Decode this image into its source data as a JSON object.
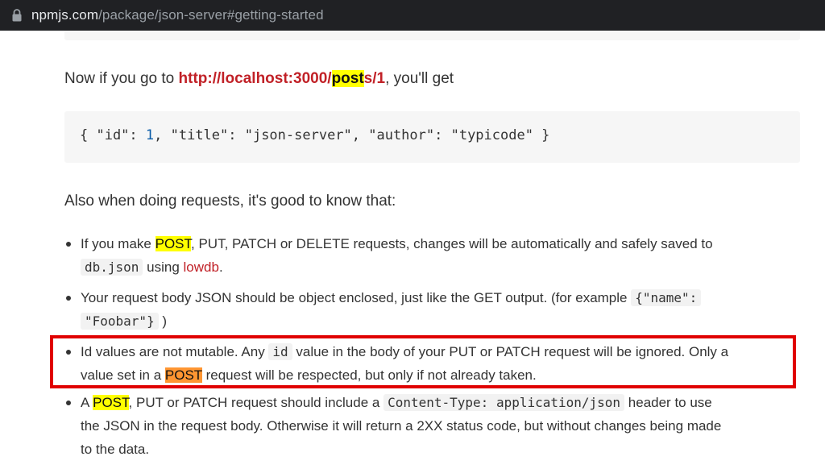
{
  "browser": {
    "url_host": "npmjs.com",
    "url_path": "/package/json-server#getting-started"
  },
  "section1": {
    "prefix": "Now if you go to ",
    "link_a": "http://localhost:3000/",
    "link_hl": "post",
    "link_b": "s/1",
    "suffix": ", you'll get"
  },
  "code": {
    "part1": "{ \"id\": ",
    "num": "1",
    "part2": ", \"title\": \"json-server\", \"author\": \"typicode\" }"
  },
  "section2": {
    "text": "Also when doing requests, it's good to know that:"
  },
  "bullets": [
    {
      "a": "If you make ",
      "hl": "POST",
      "b": ", PUT, PATCH or DELETE requests, changes will be automatically and safely saved to",
      "code": "db.json",
      "c": " using ",
      "link": "lowdb",
      "d": "."
    },
    {
      "a": "Your request body JSON should be object enclosed, just like the GET output. (for example ",
      "code1": "{\"name\":",
      "code2": "\"Foobar\"}",
      "b": " )"
    },
    {
      "a": "Id values are not mutable. Any ",
      "code": "id",
      "b": " value in the body of your PUT or PATCH request will be ignored. Only a",
      "c": "value set in a ",
      "hl": "POST",
      "d": " request will be respected, but only if not already taken."
    },
    {
      "a": "A ",
      "hl": "POST",
      "b": ", PUT or PATCH request should include a ",
      "code": "Content-Type: application/json",
      "c": " header to use",
      "d": "the JSON in the request body. Otherwise it will return a 2XX status code, but without changes being made",
      "e": "to the data."
    }
  ],
  "highlight_box_color": "#e00000"
}
